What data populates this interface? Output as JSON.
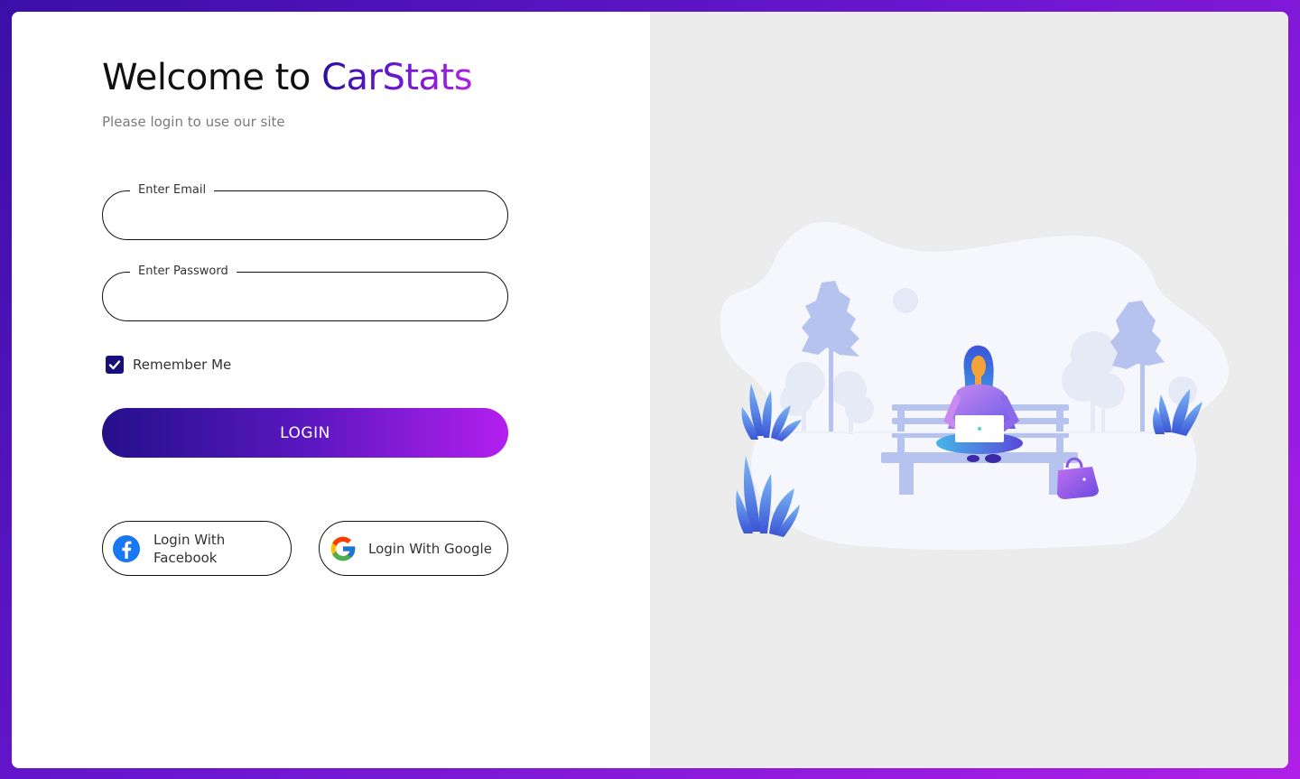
{
  "login": {
    "title_prefix": "Welcome to",
    "title_brand": "CarStats",
    "subtitle": "Please login to use our site",
    "email": {
      "label": "Enter Email",
      "value": "",
      "placeholder": ""
    },
    "password": {
      "label": "Enter Password",
      "value": "",
      "placeholder": ""
    },
    "remember_me": {
      "label": "Remember Me",
      "checked": true
    },
    "login_button": "LOGIN",
    "social": {
      "facebook_label": "Login With Facebook",
      "google_label": "Login With Google"
    }
  },
  "illustration": {
    "description_icon": "person-on-bench-with-laptop-illustration"
  },
  "colors": {
    "brand_start": "#2b10a0",
    "brand_end": "#b01fe8",
    "checkbox": "#1a0f7a",
    "facebook": "#1877f2",
    "right_panel_bg": "#ececec"
  }
}
